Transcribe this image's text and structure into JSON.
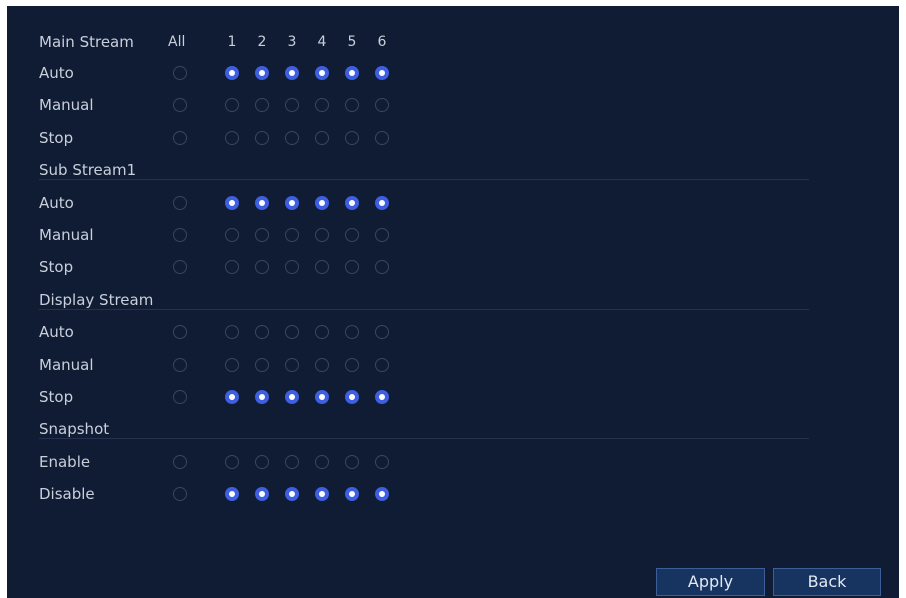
{
  "channels_header": {
    "all_label": "All",
    "channels": [
      "1",
      "2",
      "3",
      "4",
      "5",
      "6"
    ]
  },
  "sections": [
    {
      "title": "Main Stream",
      "rows": [
        {
          "label": "Auto",
          "all": false,
          "channels": [
            true,
            true,
            true,
            true,
            true,
            true
          ]
        },
        {
          "label": "Manual",
          "all": false,
          "channels": [
            false,
            false,
            false,
            false,
            false,
            false
          ]
        },
        {
          "label": "Stop",
          "all": false,
          "channels": [
            false,
            false,
            false,
            false,
            false,
            false
          ]
        }
      ]
    },
    {
      "title": "Sub Stream1",
      "rows": [
        {
          "label": "Auto",
          "all": false,
          "channels": [
            true,
            true,
            true,
            true,
            true,
            true
          ]
        },
        {
          "label": "Manual",
          "all": false,
          "channels": [
            false,
            false,
            false,
            false,
            false,
            false
          ]
        },
        {
          "label": "Stop",
          "all": false,
          "channels": [
            false,
            false,
            false,
            false,
            false,
            false
          ]
        }
      ]
    },
    {
      "title": "Display Stream",
      "rows": [
        {
          "label": "Auto",
          "all": false,
          "channels": [
            false,
            false,
            false,
            false,
            false,
            false
          ]
        },
        {
          "label": "Manual",
          "all": false,
          "channels": [
            false,
            false,
            false,
            false,
            false,
            false
          ]
        },
        {
          "label": "Stop",
          "all": false,
          "channels": [
            true,
            true,
            true,
            true,
            true,
            true
          ]
        }
      ]
    },
    {
      "title": "Snapshot",
      "rows": [
        {
          "label": "Enable",
          "all": false,
          "channels": [
            false,
            false,
            false,
            false,
            false,
            false
          ]
        },
        {
          "label": "Disable",
          "all": false,
          "channels": [
            true,
            true,
            true,
            true,
            true,
            true
          ]
        }
      ]
    }
  ],
  "buttons": {
    "apply_label": "Apply",
    "back_label": "Back"
  },
  "colors": {
    "background": "#0f1c33",
    "accent": "#3f5fe3",
    "button_fill": "#17335f",
    "text": "#c9cfdb"
  }
}
